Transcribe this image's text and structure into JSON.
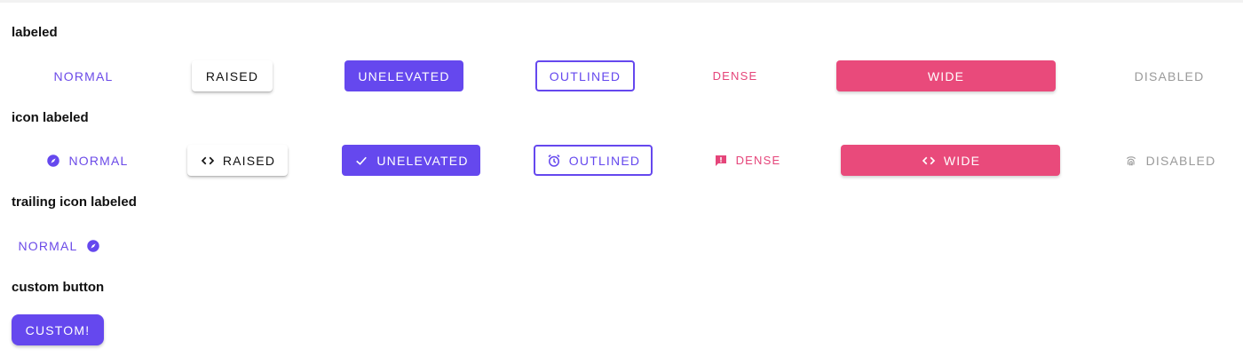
{
  "sections": {
    "labeled": "labeled",
    "icon_labeled": "icon labeled",
    "trailing_icon_labeled": "trailing icon labeled",
    "custom_button": "custom button"
  },
  "labeled": {
    "normal": "NORMAL",
    "raised": "RAISED",
    "unelevated": "UNELEVATED",
    "outlined": "OUTLINED",
    "dense": "DENSE",
    "wide": "WIDE",
    "disabled": "DISABLED"
  },
  "icon_labeled": {
    "normal": {
      "label": "NORMAL",
      "icon": "explore-icon"
    },
    "raised": {
      "label": "RAISED",
      "icon": "code-icon"
    },
    "unelevated": {
      "label": "UNELEVATED",
      "icon": "check-icon"
    },
    "outlined": {
      "label": "OUTLINED",
      "icon": "alarm-icon"
    },
    "dense": {
      "label": "DENSE",
      "icon": "feedback-icon"
    },
    "wide": {
      "label": "WIDE",
      "icon": "code-icon"
    },
    "disabled": {
      "label": "DISABLED",
      "icon": "fingerprint-icon"
    }
  },
  "trailing_icon_labeled": {
    "normal": {
      "label": "NORMAL",
      "icon": "explore-icon"
    }
  },
  "custom": {
    "label": "CUSTOM!"
  },
  "colors": {
    "primary": "#6548ee",
    "secondary": "#e94a7b",
    "disabled": "#9a9a9a"
  }
}
